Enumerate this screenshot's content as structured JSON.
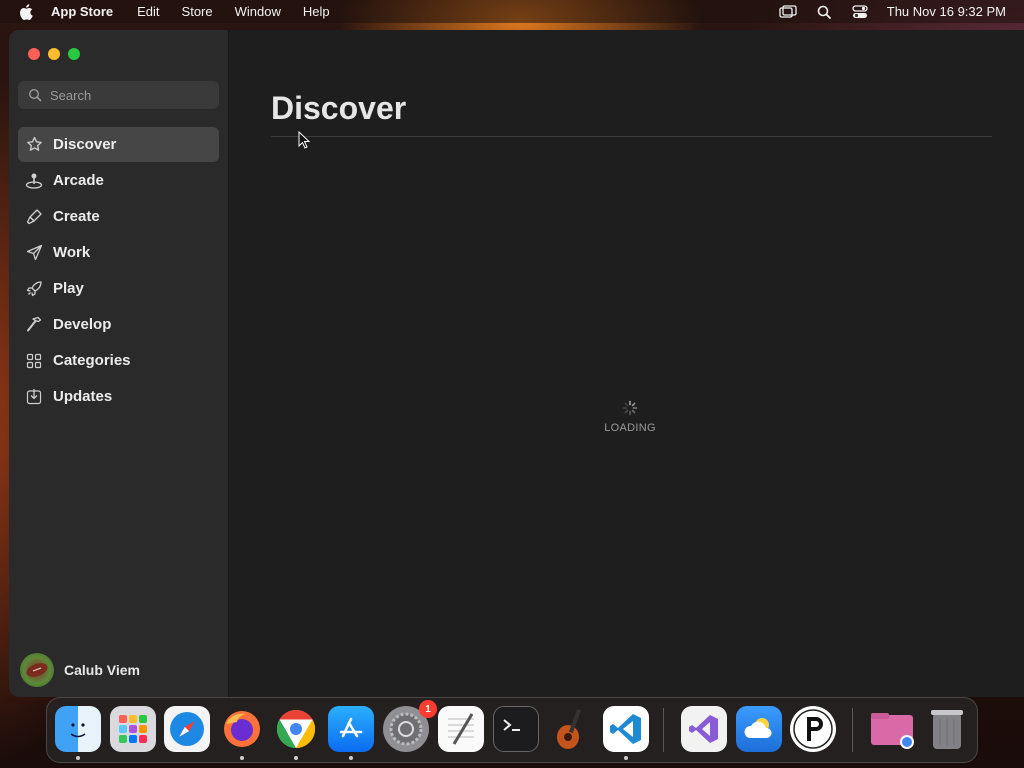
{
  "menubar": {
    "app_name": "App Store",
    "items": [
      "Edit",
      "Store",
      "Window",
      "Help"
    ],
    "clock": "Thu Nov 16  9:32 PM"
  },
  "sidebar": {
    "search_placeholder": "Search",
    "items": [
      {
        "label": "Discover",
        "icon": "star-icon",
        "active": true
      },
      {
        "label": "Arcade",
        "icon": "joystick-icon"
      },
      {
        "label": "Create",
        "icon": "brush-icon"
      },
      {
        "label": "Work",
        "icon": "paper-plane-icon"
      },
      {
        "label": "Play",
        "icon": "rocket-icon"
      },
      {
        "label": "Develop",
        "icon": "hammer-icon"
      },
      {
        "label": "Categories",
        "icon": "grid-icon"
      },
      {
        "label": "Updates",
        "icon": "download-icon"
      }
    ],
    "profile": {
      "name": "Calub Viem"
    }
  },
  "main": {
    "title": "Discover",
    "loading_text": "LOADING"
  },
  "dock": {
    "apps": [
      "Finder",
      "Launchpad",
      "Safari",
      "Firefox",
      "Chrome",
      "App Store",
      "System Settings",
      "TextEdit",
      "Terminal",
      "GarageBand",
      "Visual Studio Code",
      "Visual Studio",
      "Weather",
      "P App",
      "Downloads",
      "Trash"
    ],
    "system_settings_badge": "1"
  },
  "colors": {
    "accent_selected": "#464646",
    "sidebar_bg": "#2a2a2a",
    "content_bg": "#1e1e1e"
  }
}
